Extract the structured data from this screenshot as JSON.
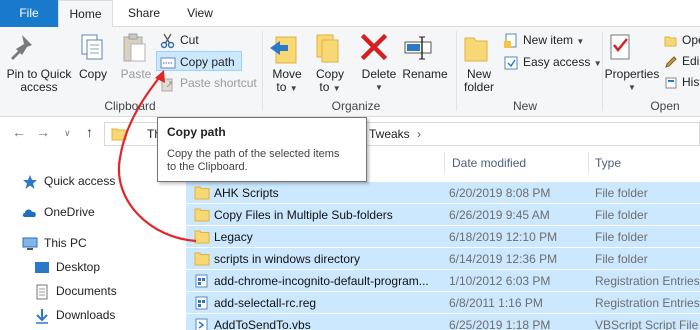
{
  "tabs": {
    "file": "File",
    "home": "Home",
    "share": "Share",
    "view": "View"
  },
  "clipboard": {
    "pin_label_1": "Pin to Quick",
    "pin_label_2": "access",
    "copy": "Copy",
    "paste": "Paste",
    "cut": "Cut",
    "copy_path": "Copy path",
    "paste_shortcut": "Paste shortcut",
    "group": "Clipboard"
  },
  "organize": {
    "move_to_1": "Move",
    "move_to_2": "to",
    "copy_to_1": "Copy",
    "copy_to_2": "to",
    "delete": "Delete",
    "rename": "Rename",
    "group": "Organize"
  },
  "new": {
    "new_folder_1": "New",
    "new_folder_2": "folder",
    "new_item": "New item",
    "easy_access": "Easy access",
    "group": "New"
  },
  "open": {
    "properties": "Properties",
    "open_btn": "Ope",
    "edit_btn": "Edi",
    "history_btn": "Hist",
    "group": "Open"
  },
  "address": {
    "crumb_start": "Th",
    "crumb_end": "Tweaks"
  },
  "tooltip": {
    "title": "Copy path",
    "desc_1": "Copy the path of the selected items",
    "desc_2": "to the Clipboard."
  },
  "nav": [
    {
      "label": "Quick access"
    },
    {
      "label": "OneDrive"
    },
    {
      "label": "This PC"
    },
    {
      "label": "Desktop"
    },
    {
      "label": "Documents"
    },
    {
      "label": "Downloads"
    }
  ],
  "columns": {
    "date": "Date modified",
    "type": "Type"
  },
  "files": [
    {
      "name": "AHK Scripts",
      "date": "6/20/2019 8:08 PM",
      "type": "File folder",
      "kind": "folder"
    },
    {
      "name": "Copy Files in Multiple Sub-folders",
      "date": "6/26/2019 9:45 AM",
      "type": "File folder",
      "kind": "folder"
    },
    {
      "name": "Legacy",
      "date": "6/18/2019 12:10 PM",
      "type": "File folder",
      "kind": "folder"
    },
    {
      "name": "scripts in windows directory",
      "date": "6/14/2019 12:36 PM",
      "type": "File folder",
      "kind": "folder"
    },
    {
      "name": "add-chrome-incognito-default-program...",
      "date": "1/10/2012 6:03 PM",
      "type": "Registration Entries",
      "kind": "reg"
    },
    {
      "name": "add-selectall-rc.reg",
      "date": "6/8/2011 1:16 PM",
      "type": "Registration Entries",
      "kind": "reg"
    },
    {
      "name": "AddToSendTo.vbs",
      "date": "6/25/2019 1:18 PM",
      "type": "VBScript Script File",
      "kind": "vbs"
    }
  ],
  "colors": {
    "file_tab": "#1979ca",
    "selection": "#cce8ff",
    "arrow": "#e0262d",
    "folder": "#f8d775"
  }
}
